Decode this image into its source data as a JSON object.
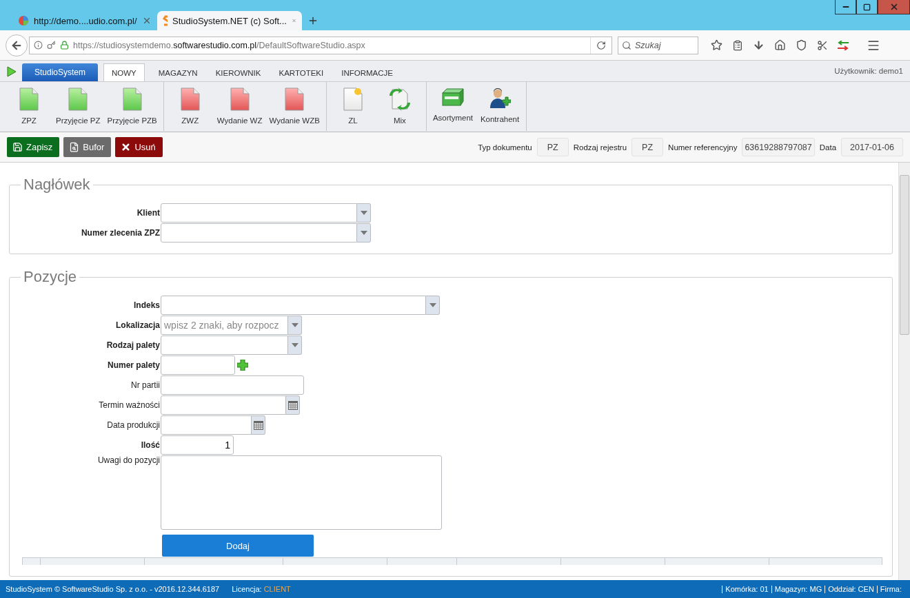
{
  "browser": {
    "tabs": [
      {
        "title": "http://demo....udio.com.pl/",
        "kind": "globe",
        "selected": false
      },
      {
        "title": "StudioSystem.NET (c) Soft...",
        "kind": "studio",
        "selected": true
      }
    ],
    "url": {
      "prefix": "https://studiosystemdemo.",
      "domain": "softwarestudio.com.pl",
      "path": "/DefaultSoftwareStudio.aspx"
    },
    "search": {
      "placeholder": "Szukaj"
    }
  },
  "app_menu": {
    "brand": "StudioSystem",
    "tabs": [
      {
        "label": "NOWY",
        "selected": true
      },
      {
        "label": "MAGAZYN",
        "selected": false
      },
      {
        "label": "KIEROWNIK",
        "selected": false
      },
      {
        "label": "KARTOTEKI",
        "selected": false
      },
      {
        "label": "INFORMACJE",
        "selected": false
      }
    ],
    "user": "Użytkownik: demo1"
  },
  "ribbon": {
    "groups": [
      {
        "items": [
          {
            "label": "ZPZ",
            "kind": "doc-in"
          },
          {
            "label": "Przyjęcie PZ",
            "kind": "doc-in"
          },
          {
            "label": "Przyjęcie PZB",
            "kind": "doc-in"
          }
        ]
      },
      {
        "items": [
          {
            "label": "ZWZ",
            "kind": "doc-out"
          },
          {
            "label": "Wydanie WZ",
            "kind": "doc-out"
          },
          {
            "label": "Wydanie WZB",
            "kind": "doc-out"
          }
        ]
      },
      {
        "items": [
          {
            "label": "ZL",
            "kind": "doc-new"
          },
          {
            "label": "Mix",
            "kind": "mix"
          }
        ]
      },
      {
        "items": [
          {
            "label": "Asortyment",
            "kind": "box"
          },
          {
            "label": "Kontrahent",
            "kind": "person"
          }
        ]
      }
    ]
  },
  "actions": [
    {
      "label": "Zapisz",
      "kind": "save"
    },
    {
      "label": "Bufor",
      "kind": "buffer"
    },
    {
      "label": "Usuń",
      "kind": "delete"
    }
  ],
  "document_info": [
    {
      "label": "Typ dokumentu",
      "value": "PZ"
    },
    {
      "label": "Rodzaj rejestru",
      "value": "PZ"
    },
    {
      "label": "Numer referencyjny",
      "value": "63619288797087"
    },
    {
      "label": "Data",
      "value": "2017-01-06"
    }
  ],
  "sections": [
    {
      "title": "Nagłówek",
      "fields": [
        {
          "label": "Klient",
          "kind": "combo",
          "required": true
        },
        {
          "label": "Numer zlecenia ZPZ",
          "kind": "combo",
          "required": true
        }
      ]
    },
    {
      "title": "Pozycje",
      "button": "Dodaj",
      "fields": [
        {
          "label": "Indeks",
          "kind": "combo",
          "required": true
        },
        {
          "label": "Lokalizacja",
          "kind": "combo",
          "required": true,
          "placeholder": "wpisz 2 znaki, aby rozpocz"
        },
        {
          "label": "Rodzaj palety",
          "kind": "combo",
          "required": true
        },
        {
          "label": "Numer palety",
          "kind": "add",
          "required": true
        },
        {
          "label": "Nr partii",
          "kind": "text",
          "required": false
        },
        {
          "label": "Termin ważności",
          "kind": "date",
          "required": false
        },
        {
          "label": "Data produkcji",
          "kind": "date",
          "required": false
        },
        {
          "label": "Ilość",
          "kind": "number",
          "required": true,
          "value": "1"
        },
        {
          "label": "Uwagi do pozycji",
          "kind": "memo",
          "required": false
        }
      ]
    }
  ],
  "status_bar": {
    "copyright": "StudioSystem © SoftwareStudio Sp. z o.o. - v2016.12.344.6187",
    "license_label": "Licencja:",
    "license": "CLIENT",
    "segments": [
      "Komórka: 01",
      "Magazyn: MG",
      "Oddział: CEN",
      "Firma:"
    ]
  }
}
